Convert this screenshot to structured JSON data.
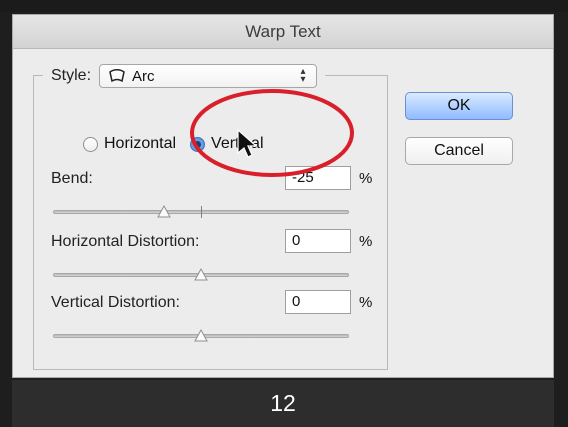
{
  "window": {
    "title": "Warp Text"
  },
  "style": {
    "label": "Style:",
    "value": "Arc"
  },
  "orientation": {
    "horizontal_label": "Horizontal",
    "vertical_label": "Vertical",
    "selected": "Vertical"
  },
  "bend": {
    "label": "Bend:",
    "value": "-25",
    "unit": "%",
    "slider_value": -25
  },
  "horizontal_distortion": {
    "label": "Horizontal Distortion:",
    "value": "0",
    "unit": "%",
    "slider_value": 0
  },
  "vertical_distortion": {
    "label": "Vertical Distortion:",
    "value": "0",
    "unit": "%",
    "slider_value": 0
  },
  "buttons": {
    "ok": "OK",
    "cancel": "Cancel"
  },
  "caption": "12",
  "colors": {
    "annotation_ring": "#d81f2a",
    "ok_button": "#8fbbff",
    "caption_background": "#2d2d2d"
  },
  "icons": {
    "style_icon": "arc-warp-icon",
    "cursor": "mouse-pointer-icon"
  }
}
